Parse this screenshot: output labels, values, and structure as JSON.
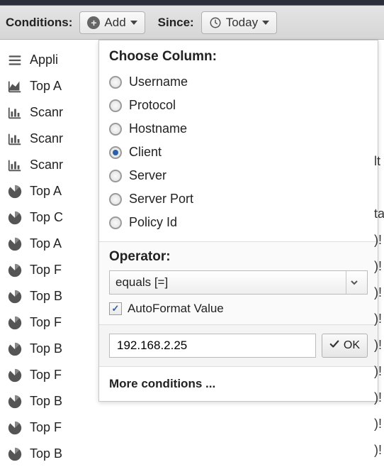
{
  "toolbar": {
    "conditions_label": "Conditions:",
    "add_label": "Add",
    "since_label": "Since:",
    "today_label": "Today"
  },
  "sidebar": {
    "items": [
      {
        "label": "Appli",
        "icon": "list"
      },
      {
        "label": "Top A",
        "icon": "area"
      },
      {
        "label": "Scanr",
        "icon": "bar"
      },
      {
        "label": "Scanr",
        "icon": "bar"
      },
      {
        "label": "Scanr",
        "icon": "bar"
      },
      {
        "label": "Top A",
        "icon": "pie"
      },
      {
        "label": "Top C",
        "icon": "pie"
      },
      {
        "label": "Top A",
        "icon": "pie"
      },
      {
        "label": "Top F",
        "icon": "pie"
      },
      {
        "label": "Top B",
        "icon": "pie"
      },
      {
        "label": "Top F",
        "icon": "pie"
      },
      {
        "label": "Top B",
        "icon": "pie"
      },
      {
        "label": "Top F",
        "icon": "pie"
      },
      {
        "label": "Top B",
        "icon": "pie"
      },
      {
        "label": "Top F",
        "icon": "pie"
      },
      {
        "label": "Top B",
        "icon": "pie"
      }
    ]
  },
  "dropdown": {
    "choose_column_label": "Choose Column:",
    "columns": [
      "Username",
      "Protocol",
      "Hostname",
      "Client",
      "Server",
      "Server Port",
      "Policy Id"
    ],
    "selected_column_index": 3,
    "operator_label": "Operator:",
    "operator_selected": "equals [=]",
    "autoformat_label": "AutoFormat Value",
    "autoformat_checked": true,
    "value_input": "192.168.2.25",
    "ok_label": "OK",
    "more_label": "More conditions ..."
  },
  "right_fragments": [
    "",
    "",
    "",
    "",
    "lt",
    "",
    "ta",
    ")!",
    ")!",
    ")!",
    ")!",
    ")!",
    ")!",
    ")!",
    ")!",
    ")!"
  ]
}
